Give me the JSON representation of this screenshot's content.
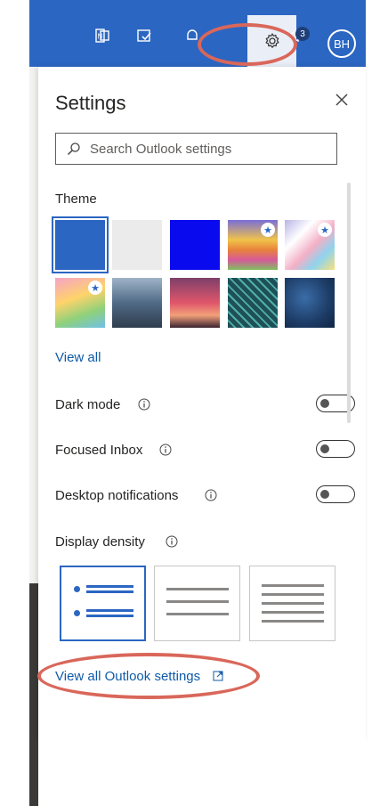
{
  "topbar": {
    "notification_count": "3",
    "avatar_initials": "BH"
  },
  "settings": {
    "title": "Settings",
    "search_placeholder": "Search Outlook settings",
    "theme_label": "Theme",
    "view_all": "View all",
    "dark_mode": "Dark mode",
    "focused_inbox": "Focused Inbox",
    "desktop_notifications": "Desktop notifications",
    "display_density": "Display density",
    "view_all_outlook_settings": "View all Outlook settings"
  },
  "colors": {
    "accent": "#2b66c2",
    "link": "#0f5ba8",
    "annotation": "#d9675a"
  }
}
